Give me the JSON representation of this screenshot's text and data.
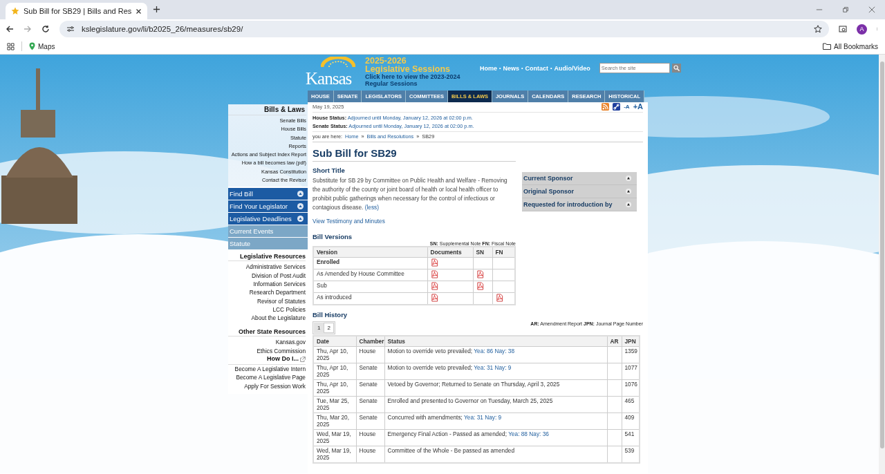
{
  "browser": {
    "tab": {
      "title": "Sub Bill for SB29 | Bills and Res"
    },
    "url": "kslegislature.gov/li/b2025_26/measures/sb29/",
    "profile": "A",
    "bookmarks": [
      "Maps"
    ],
    "all_bookmarks": "All Bookmarks"
  },
  "header": {
    "logo": "Kansas",
    "session_years": "2025-2026",
    "session_title": "Legislative Sessions",
    "previous_link": "Click here to view the 2023-2024 Regular Sessions",
    "separator": "•",
    "top_links": [
      "Home",
      "News",
      "Contact",
      "Audio/Video"
    ],
    "search": {
      "placeholder": "Search the site"
    },
    "nav": [
      {
        "label": "HOUSE",
        "selected": false
      },
      {
        "label": "SENATE",
        "selected": false
      },
      {
        "label": "LEGISLATORS",
        "selected": false
      },
      {
        "label": "COMMITTEES",
        "selected": false
      },
      {
        "label": "BILLS & LAWS",
        "selected": true
      },
      {
        "label": "JOURNALS",
        "selected": false
      },
      {
        "label": "CALENDARS",
        "selected": false
      },
      {
        "label": "RESEARCH",
        "selected": false
      },
      {
        "label": "HISTORICAL",
        "selected": false
      }
    ]
  },
  "sidebar": {
    "heading": "Bills & Laws",
    "links": [
      "Senate Bills",
      "House Bills",
      "Statute",
      "Reports",
      "Actions and Subject Index Report",
      "How a bill becomes law (pdf)",
      "Kansas Constitution",
      "Contact the Revisor"
    ],
    "panels": [
      {
        "label": "Find Bill",
        "kind": "expandable"
      },
      {
        "label": "Find Your Legislator",
        "kind": "expandable"
      },
      {
        "label": "Legislative Deadlines",
        "kind": "expandable"
      },
      {
        "label": "Current Events",
        "kind": "link"
      },
      {
        "label": "Statute",
        "kind": "link"
      }
    ],
    "resources": [
      {
        "heading": "Legislative Resources",
        "links": [
          "Administrative Services",
          "Division of Post Audit",
          "Information Services",
          "Research Department",
          "Revisor of Statutes",
          "LCC Policies",
          "About the Legislature"
        ]
      },
      {
        "heading": "Other State Resources",
        "links": [
          "Kansas.gov",
          "Ethics Commission"
        ]
      }
    ],
    "how_do_i": {
      "heading": "How Do I...",
      "links": [
        "Become A Legislative Intern",
        "Become A Legislative Page",
        "Apply For Session Work"
      ]
    }
  },
  "toolbar": {
    "date": "May 19, 2025",
    "font_smaller": "-A",
    "font_larger": "+A"
  },
  "statuses": [
    {
      "label": "House Status:",
      "value": "Adjourned until Monday, January 12, 2026 at 02:00 p.m."
    },
    {
      "label": "Senate Status:",
      "value": "Adjourned until Monday, January 12, 2026 at 02:00 p.m."
    }
  ],
  "breadcrumb": {
    "intro": "you are here:",
    "separator": "»",
    "links": [
      "Home",
      "Bills and Resolutions"
    ],
    "current": "SB29"
  },
  "bill": {
    "title": "Sub Bill for SB29",
    "short_title_heading": "Short Title",
    "short_title": "Substitute for SB 29 by Committee on Public Health and Welfare - Removing the authority of the county or joint board of health or local health officer to prohibit public gatherings when necessary for the control of infectious or contagious disease.",
    "less_link": "(less)",
    "testimony_link": "View Testimony and Minutes"
  },
  "sponsors": [
    "Current Sponsor",
    "Original Sponsor",
    "Requested for introduction by"
  ],
  "versions": {
    "heading": "Bill Versions",
    "legend": "**SN:** Supplemental Note **FN:** Fiscal Note",
    "columns": [
      "Version",
      "Documents",
      "SN",
      "FN"
    ],
    "rows": [
      {
        "version": "Enrolled",
        "emphasized": true,
        "document": true,
        "sn": false,
        "fn": false
      },
      {
        "version": "As Amended by House Committee",
        "emphasized": false,
        "document": true,
        "sn": true,
        "fn": false
      },
      {
        "version": "Sub",
        "emphasized": false,
        "document": true,
        "sn": true,
        "fn": false
      },
      {
        "version": "As introduced",
        "emphasized": false,
        "document": true,
        "sn": false,
        "fn": true
      }
    ]
  },
  "history": {
    "heading": "Bill History",
    "pages": [
      {
        "label": "1",
        "selected": true
      },
      {
        "label": "2",
        "selected": false
      }
    ],
    "legend": "**AR:** Amendment Report **JPN:** Journal Page Number",
    "columns": [
      "Date",
      "Chamber",
      "Status",
      "AR",
      "JPN"
    ],
    "rows": [
      {
        "date": "Thu, Apr 10, 2025",
        "chamber": "House",
        "status": "Motion to override veto prevailed;",
        "vote": "Yea: 86 Nay: 38",
        "jpn": "1359"
      },
      {
        "date": "Thu, Apr 10, 2025",
        "chamber": "Senate",
        "status": "Motion to override veto prevailed;",
        "vote": "Yea: 31 Nay: 9",
        "jpn": "1077"
      },
      {
        "date": "Thu, Apr 10, 2025",
        "chamber": "Senate",
        "status": "Vetoed by Governor; Returned to Senate on Thursday, April 3, 2025",
        "jpn": "1076"
      },
      {
        "date": "Tue, Mar 25, 2025",
        "chamber": "Senate",
        "status": "Enrolled and presented to Governor on Tuesday, March 25, 2025",
        "jpn": "465"
      },
      {
        "date": "Thu, Mar 20, 2025",
        "chamber": "Senate",
        "status": "Concurred with amendments;",
        "vote": "Yea: 31 Nay: 9",
        "jpn": "409"
      },
      {
        "date": "Wed, Mar 19, 2025",
        "chamber": "House",
        "status": "Emergency Final Action - Passed as amended;",
        "vote": "Yea: 88 Nay: 36",
        "jpn": "541"
      },
      {
        "date": "Wed, Mar 19, 2025",
        "chamber": "House",
        "status": "Committee of the Whole - Be passed as amended",
        "jpn": "539"
      }
    ]
  }
}
